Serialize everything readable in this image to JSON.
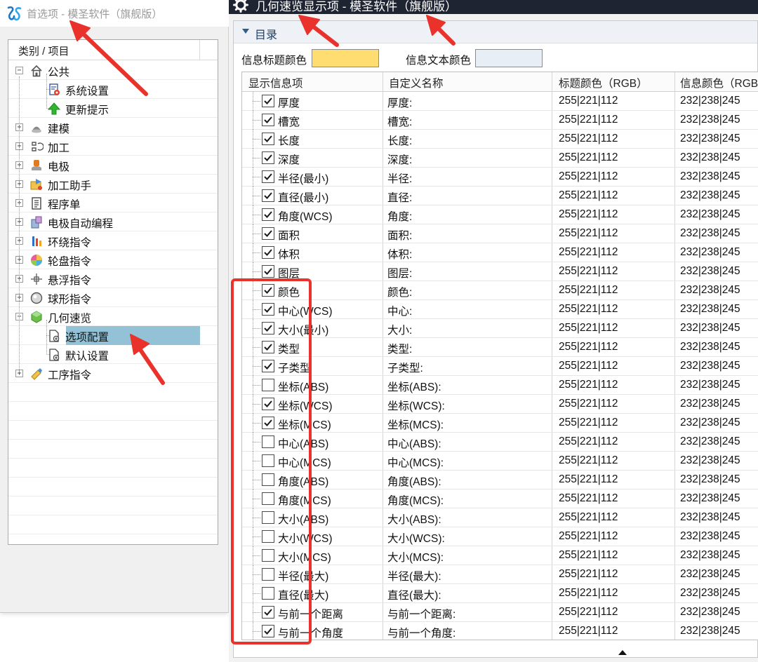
{
  "left_window": {
    "title": "首选项 - 模圣软件（旗舰版）",
    "tree_header": "类别 / 项目",
    "tree": [
      {
        "id": "public",
        "label": "公共",
        "toggle": "−",
        "level": 0,
        "icon": "house-icon"
      },
      {
        "id": "system-settings",
        "label": "系统设置",
        "level": 1,
        "icon": "settings-document-icon"
      },
      {
        "id": "update-tips",
        "label": "更新提示",
        "level": 1,
        "icon": "green-up-arrow-icon"
      },
      {
        "id": "modeling",
        "label": "建模",
        "toggle": "+",
        "level": 0,
        "icon": "modeling-icon"
      },
      {
        "id": "machining",
        "label": "加工",
        "toggle": "+",
        "level": 0,
        "icon": "machining-icon"
      },
      {
        "id": "electrode",
        "label": "电极",
        "toggle": "+",
        "level": 0,
        "icon": "electrode-icon"
      },
      {
        "id": "machining-assistant",
        "label": "加工助手",
        "toggle": "+",
        "level": 0,
        "icon": "machining-assistant-icon"
      },
      {
        "id": "program-sheet",
        "label": "程序单",
        "toggle": "+",
        "level": 0,
        "icon": "program-sheet-icon"
      },
      {
        "id": "electrode-auto-programming",
        "label": "电极自动编程",
        "toggle": "+",
        "level": 0,
        "icon": "electrode-programming-icon"
      },
      {
        "id": "wrap-command",
        "label": "环绕指令",
        "toggle": "+",
        "level": 0,
        "icon": "wrap-icon"
      },
      {
        "id": "wheel-command",
        "label": "轮盘指令",
        "toggle": "+",
        "level": 0,
        "icon": "wheel-icon"
      },
      {
        "id": "float-command",
        "label": "悬浮指令",
        "toggle": "+",
        "level": 0,
        "icon": "float-icon"
      },
      {
        "id": "ball-command",
        "label": "球形指令",
        "toggle": "+",
        "level": 0,
        "icon": "ball-icon"
      },
      {
        "id": "geometry-preview",
        "label": "几何速览",
        "toggle": "−",
        "level": 0,
        "icon": "geometry-cube-icon"
      },
      {
        "id": "option-config",
        "label": "选项配置",
        "level": 1,
        "icon": "config-document-icon",
        "selected": true
      },
      {
        "id": "default-settings",
        "label": "默认设置",
        "level": 1,
        "icon": "config-document-icon"
      },
      {
        "id": "process-command",
        "label": "工序指令",
        "toggle": "+",
        "level": 0,
        "icon": "process-icon"
      }
    ]
  },
  "right_window": {
    "title": "几何速览显示项 - 模圣软件（旗舰版）",
    "catalog_label": "目录",
    "title_color_label": "信息标题颜色",
    "title_color": "#ffdd70",
    "text_color_label": "信息文本颜色",
    "text_color": "#e8eef5",
    "columns": [
      "显示信息项",
      "自定义名称",
      "标题颜色（RGB）",
      "信息颜色（RGB）"
    ],
    "rows": [
      {
        "checked": true,
        "name": "厚度",
        "custom": "厚度:",
        "title_rgb": "255|221|112",
        "info_rgb": "232|238|245"
      },
      {
        "checked": true,
        "name": "槽宽",
        "custom": "槽宽:",
        "title_rgb": "255|221|112",
        "info_rgb": "232|238|245"
      },
      {
        "checked": true,
        "name": "长度",
        "custom": "长度:",
        "title_rgb": "255|221|112",
        "info_rgb": "232|238|245"
      },
      {
        "checked": true,
        "name": "深度",
        "custom": "深度:",
        "title_rgb": "255|221|112",
        "info_rgb": "232|238|245"
      },
      {
        "checked": true,
        "name": "半径(最小)",
        "custom": "半径:",
        "title_rgb": "255|221|112",
        "info_rgb": "232|238|245"
      },
      {
        "checked": true,
        "name": "直径(最小)",
        "custom": "直径:",
        "title_rgb": "255|221|112",
        "info_rgb": "232|238|245"
      },
      {
        "checked": true,
        "name": "角度(WCS)",
        "custom": "角度:",
        "title_rgb": "255|221|112",
        "info_rgb": "232|238|245"
      },
      {
        "checked": true,
        "name": "面积",
        "custom": "面积:",
        "title_rgb": "255|221|112",
        "info_rgb": "232|238|245"
      },
      {
        "checked": true,
        "name": "体积",
        "custom": "体积:",
        "title_rgb": "255|221|112",
        "info_rgb": "232|238|245"
      },
      {
        "checked": true,
        "name": "图层",
        "custom": "图层:",
        "title_rgb": "255|221|112",
        "info_rgb": "232|238|245"
      },
      {
        "checked": true,
        "name": "颜色",
        "custom": "颜色:",
        "title_rgb": "255|221|112",
        "info_rgb": "232|238|245"
      },
      {
        "checked": true,
        "name": "中心(WCS)",
        "custom": "中心:",
        "title_rgb": "255|221|112",
        "info_rgb": "232|238|245"
      },
      {
        "checked": true,
        "name": "大小(最小)",
        "custom": "大小:",
        "title_rgb": "255|221|112",
        "info_rgb": "232|238|245"
      },
      {
        "checked": true,
        "name": "类型",
        "custom": "类型:",
        "title_rgb": "255|221|112",
        "info_rgb": "232|238|245"
      },
      {
        "checked": true,
        "name": "子类型",
        "custom": "子类型:",
        "title_rgb": "255|221|112",
        "info_rgb": "232|238|245"
      },
      {
        "checked": false,
        "name": "坐标(ABS)",
        "custom": "坐标(ABS):",
        "title_rgb": "255|221|112",
        "info_rgb": "232|238|245"
      },
      {
        "checked": true,
        "name": "坐标(WCS)",
        "custom": "坐标(WCS):",
        "title_rgb": "255|221|112",
        "info_rgb": "232|238|245"
      },
      {
        "checked": true,
        "name": "坐标(MCS)",
        "custom": "坐标(MCS):",
        "title_rgb": "255|221|112",
        "info_rgb": "232|238|245"
      },
      {
        "checked": false,
        "name": "中心(ABS)",
        "custom": "中心(ABS):",
        "title_rgb": "255|221|112",
        "info_rgb": "232|238|245"
      },
      {
        "checked": false,
        "name": "中心(MCS)",
        "custom": "中心(MCS):",
        "title_rgb": "255|221|112",
        "info_rgb": "232|238|245"
      },
      {
        "checked": false,
        "name": "角度(ABS)",
        "custom": "角度(ABS):",
        "title_rgb": "255|221|112",
        "info_rgb": "232|238|245"
      },
      {
        "checked": false,
        "name": "角度(MCS)",
        "custom": "角度(MCS):",
        "title_rgb": "255|221|112",
        "info_rgb": "232|238|245"
      },
      {
        "checked": false,
        "name": "大小(ABS)",
        "custom": "大小(ABS):",
        "title_rgb": "255|221|112",
        "info_rgb": "232|238|245"
      },
      {
        "checked": false,
        "name": "大小(WCS)",
        "custom": "大小(WCS):",
        "title_rgb": "255|221|112",
        "info_rgb": "232|238|245"
      },
      {
        "checked": false,
        "name": "大小(MCS)",
        "custom": "大小(MCS):",
        "title_rgb": "255|221|112",
        "info_rgb": "232|238|245"
      },
      {
        "checked": false,
        "name": "半径(最大)",
        "custom": "半径(最大):",
        "title_rgb": "255|221|112",
        "info_rgb": "232|238|245"
      },
      {
        "checked": false,
        "name": "直径(最大)",
        "custom": "直径(最大):",
        "title_rgb": "255|221|112",
        "info_rgb": "232|238|245"
      },
      {
        "checked": true,
        "name": "与前一个距离",
        "custom": "与前一个距离:",
        "title_rgb": "255|221|112",
        "info_rgb": "232|238|245"
      },
      {
        "checked": true,
        "name": "与前一个角度",
        "custom": "与前一个角度:",
        "title_rgb": "255|221|112",
        "info_rgb": "232|238|245"
      }
    ]
  },
  "annotation_color": "#e8322b"
}
